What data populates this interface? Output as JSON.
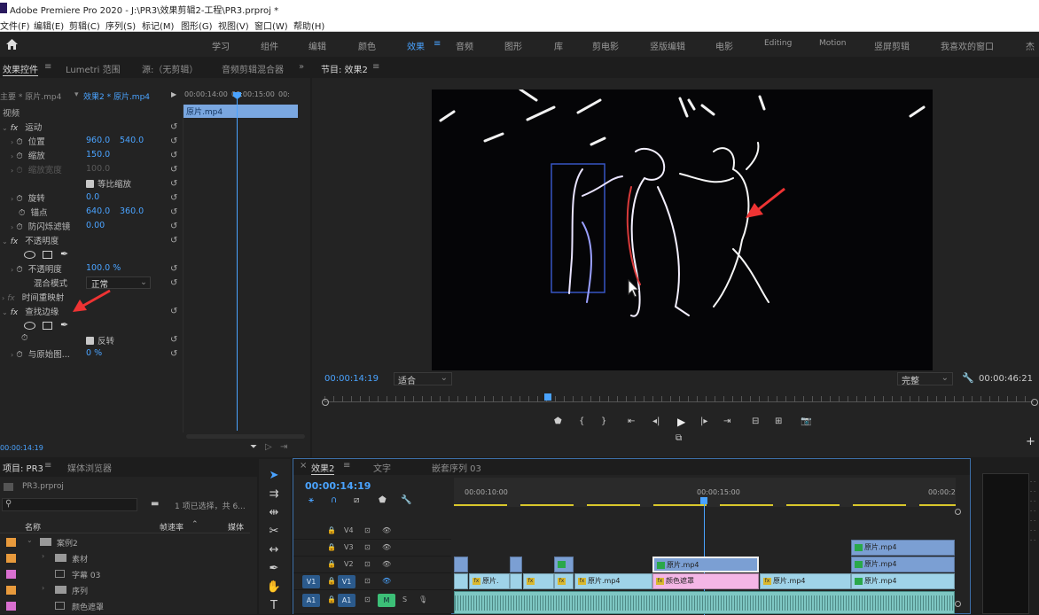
{
  "titlebar": {
    "title": "Adobe Premiere Pro 2020 - J:\\PR3\\效果剪辑2-工程\\PR3.prproj *"
  },
  "menu": [
    "文件(F)",
    "编辑(E)",
    "剪辑(C)",
    "序列(S)",
    "标记(M)",
    "图形(G)",
    "视图(V)",
    "窗口(W)",
    "帮助(H)"
  ],
  "workspaces": [
    "学习",
    "组件",
    "编辑",
    "颜色",
    "效果",
    "音频",
    "图形",
    "库",
    "剪电影",
    "竖版编辑",
    "电影",
    "Editing",
    "Motion",
    "竖屏剪辑",
    "我喜欢的窗口",
    "杰"
  ],
  "effect_controls": {
    "tabs": [
      "效果控件",
      "Lumetri 范围",
      "源:（无剪辑）",
      "音频剪辑混合器"
    ],
    "master": "主要 * 原片.mp4",
    "clip": "效果2 * 原片.mp4",
    "ruler": [
      "00:00:14:00",
      "00:00:15:00",
      "00:"
    ],
    "mini_clip": "原片.mp4",
    "section_video": "视频",
    "motion": "运动",
    "position": {
      "label": "位置",
      "x": "960.0",
      "y": "540.0"
    },
    "scale": {
      "label": "缩放",
      "value": "150.0"
    },
    "scale_width": {
      "label": "缩放宽度",
      "value": "100.0"
    },
    "uniform": "等比缩放",
    "rotation": {
      "label": "旋转",
      "value": "0.0"
    },
    "anchor": {
      "label": "锚点",
      "x": "640.0",
      "y": "360.0"
    },
    "antiflicker": {
      "label": "防闪烁滤镜",
      "value": "0.00"
    },
    "opacity_fx": "不透明度",
    "opacity": {
      "label": "不透明度",
      "value": "100.0 %"
    },
    "blend": {
      "label": "混合模式",
      "value": "正常"
    },
    "time_remap": "时间重映射",
    "find_edges": "查找边缘",
    "invert": "反转",
    "blend_original": {
      "label": "与原始图...",
      "value": "0 %"
    },
    "timecode": "00:00:14:19"
  },
  "program": {
    "title": "节目: 效果2",
    "timecode": "00:00:14:19",
    "fit": "适合",
    "quality": "完整",
    "duration": "00:00:46:21"
  },
  "project": {
    "tabs": [
      "项目: PR3",
      "媒体浏览器"
    ],
    "file": "PR3.prproj",
    "selection": "1 项已选择，共 6...",
    "columns": {
      "name": "名称",
      "fps": "帧速率",
      "media": "媒体"
    },
    "items": [
      {
        "name": "案例2",
        "color": "#e89a3c",
        "kind": "bin",
        "expanded": true,
        "indent": 0
      },
      {
        "name": "素材",
        "color": "#e89a3c",
        "kind": "bin",
        "indent": 1
      },
      {
        "name": "字幕 03",
        "color": "#d96fd0",
        "kind": "item",
        "indent": 1
      },
      {
        "name": "序列",
        "color": "#e89a3c",
        "kind": "bin",
        "indent": 1
      },
      {
        "name": "颜色遮罩",
        "color": "#d96fd0",
        "kind": "item",
        "indent": 1
      }
    ]
  },
  "timeline": {
    "tabs": [
      "效果2",
      "文字",
      "嵌套序列 03"
    ],
    "timecode": "00:00:14:19",
    "ruler": [
      "00:00:10:00",
      "00:00:15:00",
      "00:00:2"
    ],
    "tracks": [
      "V4",
      "V3",
      "V2",
      "V1",
      "A1"
    ],
    "src_v1": "V1",
    "src_a1": "A1",
    "mute": "M",
    "solo": "S",
    "clips": {
      "c1": "原片.",
      "c2": "原片.mp4",
      "c3": "原片.mp4",
      "c4": "原片.mp4",
      "mask_v2": "原片.mp4",
      "color_mask": "颜色遮罩",
      "v3": "原片.mp4",
      "v2_right": "原片.mp4",
      "v1_right": "原片.mp4"
    }
  },
  "colors": {
    "accent": "#4aa3ff",
    "clip_v1": "#9fd3e8",
    "clip_v2": "#7b9fd3",
    "pink": "#f4b6e6",
    "fx": "#d9b82f"
  }
}
